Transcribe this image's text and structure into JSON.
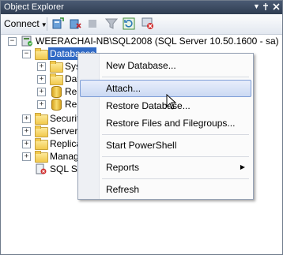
{
  "window": {
    "title": "Object Explorer"
  },
  "toolbar": {
    "connect_label": "Connect",
    "connect_caret": "▼"
  },
  "tree": {
    "server": "WEERACHAI-NB\\SQL2008 (SQL Server 10.50.1600 - sa)",
    "databases": "Databases",
    "sys_partial": "Syst",
    "db_partial": "Dat",
    "rep1_partial": "Rep",
    "rep2_partial": "Rep",
    "security_partial": "Securit",
    "server_objects_partial": "Server",
    "replication_partial": "Replica",
    "management_partial": "Manage",
    "agent_partial": "SQL Se"
  },
  "menu": {
    "new_database": "New Database...",
    "attach": "Attach...",
    "restore_database": "Restore Database...",
    "restore_files": "Restore Files and Filegroups...",
    "start_powershell": "Start PowerShell",
    "reports": "Reports",
    "refresh": "Refresh"
  },
  "icons": {
    "pin": "pin-icon",
    "close": "close-icon",
    "submenu_arrow": "▶"
  },
  "colors": {
    "selection": "#316ac5",
    "titlebar": "#3a4a63"
  }
}
